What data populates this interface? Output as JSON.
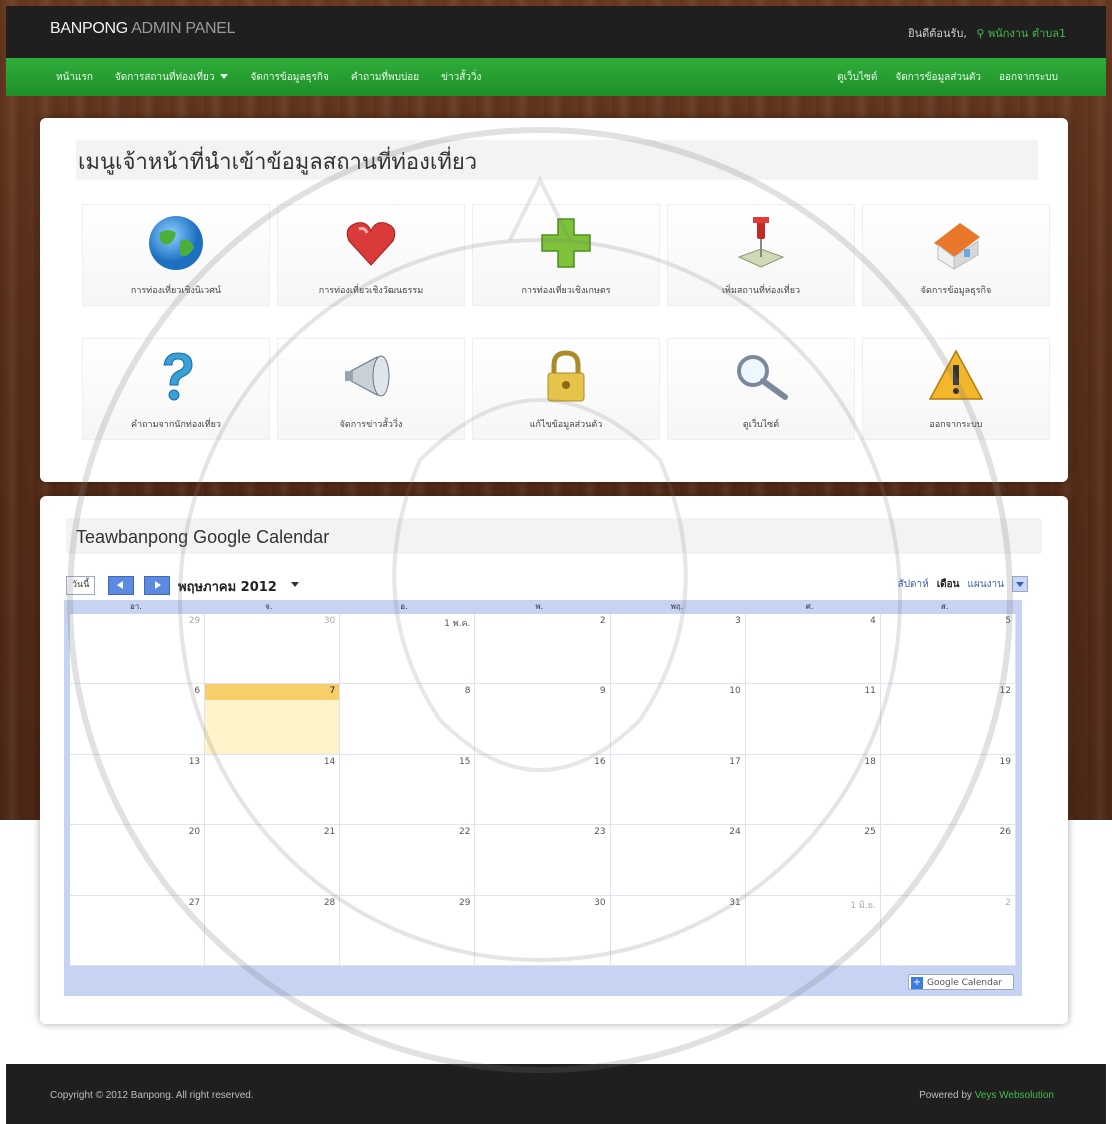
{
  "header": {
    "brand_part1": "BANPONG",
    "brand_part2": "ADMIN PANEL",
    "welcome_label": "ยินดีต้อนรับ,",
    "user_name": "พนักงาน ตำบล1"
  },
  "nav": {
    "left": [
      {
        "label": "หน้าแรก"
      },
      {
        "label": "จัดการสถานที่ท่องเที่ยว",
        "has_dropdown": true
      },
      {
        "label": "จัดการข้อมูลธุรกิจ"
      },
      {
        "label": "คำถามที่พบบ่อย"
      },
      {
        "label": "ข่าวสั้ววิ่ง"
      }
    ],
    "right": [
      {
        "label": "ดูเว็บไซต์"
      },
      {
        "label": "จัดการข้อมูลส่วนตัว"
      },
      {
        "label": "ออกจากระบบ"
      }
    ]
  },
  "menu_panel": {
    "title": "เมนูเจ้าหน้าที่นำเข้าข้อมูลสถานที่ท่องเที่ยว",
    "tiles": [
      {
        "icon": "globe-icon",
        "label": "การท่องเที่ยวเชิงนิเวศน์"
      },
      {
        "icon": "heart-icon",
        "label": "การท่องเที่ยวเชิงวัฒนธรรม"
      },
      {
        "icon": "plus-icon",
        "label": "การท่องเที่ยวเชิงเกษตร"
      },
      {
        "icon": "map-pin-icon",
        "label": "เพิ่มสถานที่ท่องเที่ยว"
      },
      {
        "icon": "house-icon",
        "label": "จัดการข้อมูลธุรกิจ"
      },
      {
        "icon": "question-icon",
        "label": "คำถามจากนักท่องเที่ยว"
      },
      {
        "icon": "megaphone-icon",
        "label": "จัดการข่าวสั้ววิ่ง"
      },
      {
        "icon": "lock-icon",
        "label": "แก้ไขข้อมูลส่วนตัว"
      },
      {
        "icon": "magnifier-icon",
        "label": "ดูเว็บไซต์"
      },
      {
        "icon": "warning-icon",
        "label": "ออกจากระบบ"
      }
    ]
  },
  "calendar": {
    "title": "Teawbanpong Google Calendar",
    "today_button": "วันนี้",
    "month_label": "พฤษภาคม 2012",
    "views": [
      {
        "label": "สัปดาห์",
        "active": false
      },
      {
        "label": "เดือน",
        "active": true
      },
      {
        "label": "แผนงาน",
        "active": false
      }
    ],
    "weekdays": [
      "อา.",
      "จ.",
      "อ.",
      "พ.",
      "พฤ.",
      "ศ.",
      "ส."
    ],
    "cells": [
      {
        "n": "29",
        "other": true
      },
      {
        "n": "30",
        "other": true
      },
      {
        "n": "1 พ.ค."
      },
      {
        "n": "2"
      },
      {
        "n": "3"
      },
      {
        "n": "4"
      },
      {
        "n": "5"
      },
      {
        "n": "6"
      },
      {
        "n": "7",
        "today": true
      },
      {
        "n": "8"
      },
      {
        "n": "9"
      },
      {
        "n": "10"
      },
      {
        "n": "11"
      },
      {
        "n": "12"
      },
      {
        "n": "13"
      },
      {
        "n": "14"
      },
      {
        "n": "15"
      },
      {
        "n": "16"
      },
      {
        "n": "17"
      },
      {
        "n": "18"
      },
      {
        "n": "19"
      },
      {
        "n": "20"
      },
      {
        "n": "21"
      },
      {
        "n": "22"
      },
      {
        "n": "23"
      },
      {
        "n": "24"
      },
      {
        "n": "25"
      },
      {
        "n": "26"
      },
      {
        "n": "27"
      },
      {
        "n": "28"
      },
      {
        "n": "29"
      },
      {
        "n": "30"
      },
      {
        "n": "31"
      },
      {
        "n": "1 มิ.ย.",
        "other": true
      },
      {
        "n": "2",
        "other": true
      }
    ],
    "badge": "Google Calendar"
  },
  "footer": {
    "copyright": "Copyright © 2012 Banpong. All right reserved.",
    "powered_label": "Powered by",
    "powered_vendor": "Veys Websolution"
  },
  "colors": {
    "nav_green": "#2fae3a",
    "topbar": "#1f1f1f",
    "accent_green": "#3fbf4a",
    "today_yellow": "#f6cf6a"
  }
}
